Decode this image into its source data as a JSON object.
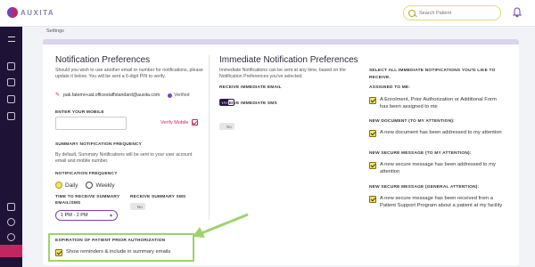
{
  "app": {
    "brand": "AUXITA"
  },
  "header": {
    "search_placeholder": "Search Patient"
  },
  "breadcrumb": "Settings",
  "notification_prefs": {
    "title": "Notification Preferences",
    "description": "Should you wish to use another email or number for notifications, please update it below. You will be sent a 6-digit PIN to verify.",
    "email": "pak.fatemi+uat.officestaffstandard@auxita.com",
    "verified_label": "Verified",
    "mobile_label": "ENTER YOUR MOBILE",
    "mobile_value": "",
    "verify_mobile_label": "Verify Mobile",
    "summary_title": "SUMMARY NOTIFICATION FREQUENCY",
    "summary_desc": "By default, Summary Notifications will be sent to your user account email and mobile number.",
    "frequency_label": "NOTIFICATION FREQUENCY",
    "freq_daily": "Daily",
    "freq_weekly": "Weekly",
    "selected_frequency": "Daily",
    "time_label": "TIME TO RECEIVE SUMMARY EMAIL/SMS",
    "time_value": "1 PM - 2 PM",
    "receive_sms_label": "RECEIVE SUMMARY SMS",
    "receive_sms_value": "No",
    "expiry_title": "EXPIRATION OF PATIENT PRIOR AUTHORIZATION",
    "expiry_checkbox_label": "Show reminders & include in summary emails"
  },
  "immediate": {
    "title": "Immediate Notification Preferences",
    "description": "Immediate Notifications can be sent at any time, based on the Notification Preferences you've selected.",
    "receive_email_label": "RECEIVE IMMEDIATE EMAIL",
    "receive_email_value": "Yes",
    "receive_sms_label": "RECEIVE IMMEDIATE SMS",
    "receive_sms_value": "No",
    "select_all_label": "SELECT ALL IMMEDIATE NOTIFICATIONS YOU'D LIKE TO RECEIVE.",
    "groups": [
      {
        "heading": "ASSIGNED TO ME:",
        "item": "A Enrolment, Prior Authorization or Additional Form has been assigned to me"
      },
      {
        "heading": "NEW DOCUMENT (TO MY ATTENTION):",
        "item": "A new document has been addressed to my attention"
      },
      {
        "heading": "NEW SECURE MESSAGE (TO MY ATTENTION):",
        "item": "A new secure message has been addressed to my attention"
      },
      {
        "heading": "NEW SECURE MESSAGE (GENERAL ATTENTION):",
        "item": "A new secure message has been received from a Patient Support Program about a patient at my facility"
      }
    ]
  },
  "colors": {
    "accent": "#c22660",
    "primary": "#7a3fb8",
    "sidebar": "#1f1237",
    "checkbox": "#f2e46a",
    "highlight": "#9ed36a"
  },
  "icons": [
    "logo-icon",
    "search-icon",
    "bell-icon",
    "menu-icon",
    "home-icon",
    "patients-icon",
    "documents-icon",
    "forms-icon",
    "logout-icon",
    "user-icon",
    "help-icon",
    "settings-icon",
    "pen-icon",
    "verified-icon",
    "checkbox-icon",
    "chevron-down-icon"
  ]
}
